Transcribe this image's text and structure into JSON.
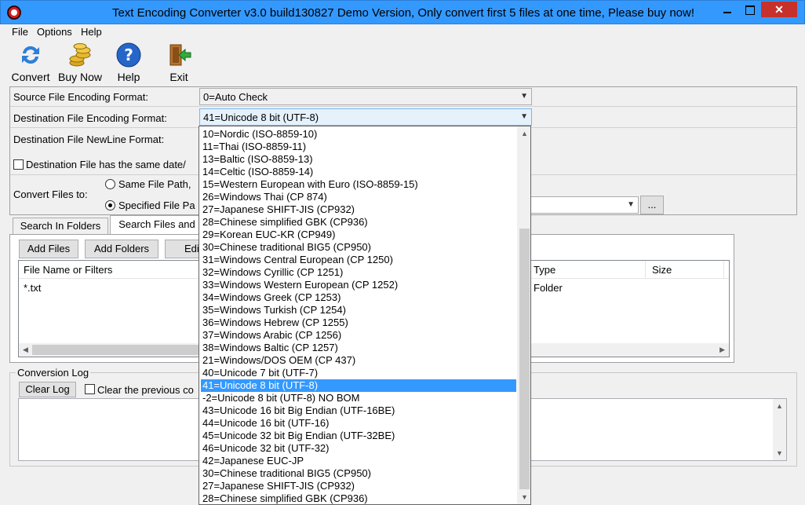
{
  "window": {
    "title": "Text Encoding Converter v3.0 build130827 Demo Version, Only convert first 5 files at one time, Please buy now!",
    "close_glyph": "✕"
  },
  "menu": [
    "File",
    "Options",
    "Help"
  ],
  "toolbar": {
    "convert": "Convert",
    "buy_now": "Buy Now",
    "help": "Help",
    "exit": "Exit"
  },
  "source": {
    "label": "Source File Encoding Format:",
    "value": "0=Auto Check"
  },
  "destination": {
    "label": "Destination File Encoding Format:",
    "value": "41=Unicode 8 bit (UTF-8)",
    "newline_label": "Destination File NewLine Format:",
    "same_date_label": "Destination File has the same date/"
  },
  "convert_to": {
    "label": "Convert Files to:",
    "same_path": "Same File Path,",
    "specified": "Specified File Pa",
    "browse": "..."
  },
  "tabs": {
    "search_in_folders": "Search In Folders",
    "search_files_and": "Search Files and"
  },
  "buttons": {
    "add_files": "Add Files",
    "add_folders": "Add Folders",
    "edit": "Edi"
  },
  "file_list": {
    "columns": [
      "File Name or Filters",
      "Type",
      "Size"
    ],
    "rows": [
      {
        "name": "*.txt",
        "type": "Folder",
        "size": ""
      }
    ]
  },
  "log": {
    "label": "Conversion Log",
    "clear": "Clear Log",
    "clear_previous": "Clear the previous co"
  },
  "encoding_options": [
    {
      "label": "10=Nordic (ISO-8859-10)",
      "selected": false
    },
    {
      "label": "11=Thai (ISO-8859-11)",
      "selected": false
    },
    {
      "label": "13=Baltic (ISO-8859-13)",
      "selected": false
    },
    {
      "label": "14=Celtic (ISO-8859-14)",
      "selected": false
    },
    {
      "label": "15=Western European with Euro (ISO-8859-15)",
      "selected": false
    },
    {
      "label": "26=Windows Thai (CP 874)",
      "selected": false
    },
    {
      "label": "27=Japanese SHIFT-JIS (CP932)",
      "selected": false
    },
    {
      "label": "28=Chinese simplified GBK (CP936)",
      "selected": false
    },
    {
      "label": "29=Korean EUC-KR (CP949)",
      "selected": false
    },
    {
      "label": "30=Chinese traditional BIG5 (CP950)",
      "selected": false
    },
    {
      "label": "31=Windows Central European (CP 1250)",
      "selected": false
    },
    {
      "label": "32=Windows Cyrillic (CP 1251)",
      "selected": false
    },
    {
      "label": "33=Windows Western European (CP 1252)",
      "selected": false
    },
    {
      "label": "34=Windows Greek (CP 1253)",
      "selected": false
    },
    {
      "label": "35=Windows Turkish (CP 1254)",
      "selected": false
    },
    {
      "label": "36=Windows Hebrew (CP 1255)",
      "selected": false
    },
    {
      "label": "37=Windows Arabic (CP 1256)",
      "selected": false
    },
    {
      "label": "38=Windows Baltic (CP 1257)",
      "selected": false
    },
    {
      "label": "21=Windows/DOS OEM (CP 437)",
      "selected": false
    },
    {
      "label": "40=Unicode 7 bit (UTF-7)",
      "selected": false
    },
    {
      "label": "41=Unicode 8 bit (UTF-8)",
      "selected": true
    },
    {
      "label": "-2=Unicode 8 bit (UTF-8) NO BOM",
      "selected": false
    },
    {
      "label": "43=Unicode 16 bit Big Endian (UTF-16BE)",
      "selected": false
    },
    {
      "label": "44=Unicode 16 bit (UTF-16)",
      "selected": false
    },
    {
      "label": "45=Unicode 32 bit Big Endian (UTF-32BE)",
      "selected": false
    },
    {
      "label": "46=Unicode 32 bit (UTF-32)",
      "selected": false
    },
    {
      "label": "42=Japanese EUC-JP",
      "selected": false
    },
    {
      "label": "30=Chinese traditional BIG5 (CP950)",
      "selected": false
    },
    {
      "label": "27=Japanese SHIFT-JIS (CP932)",
      "selected": false
    },
    {
      "label": "28=Chinese simplified GBK (CP936)",
      "selected": false
    }
  ],
  "colors": {
    "titlebar": "#3399ff",
    "selection": "#3399ff",
    "close_button": "#c7312b"
  }
}
